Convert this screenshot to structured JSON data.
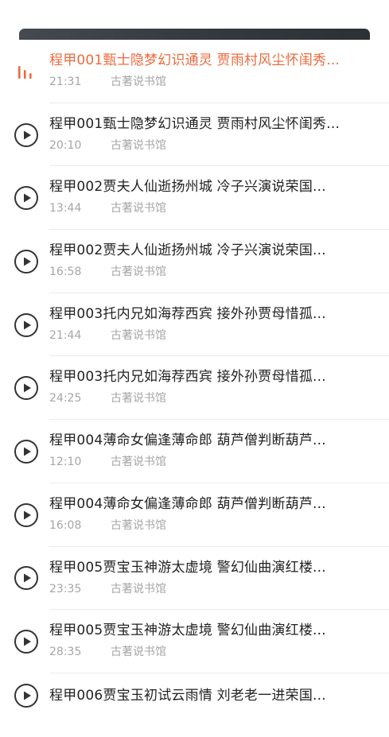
{
  "player": {
    "active_icon": "playing-bars-icon",
    "play_icon": "play-circle-icon",
    "accent_color": "#ec6a3e"
  },
  "episodes": [
    {
      "title": "程甲001甄士隐梦幻识通灵 贾雨村风尘怀闺秀...",
      "duration": "21:31",
      "author": "古著说书馆",
      "playing": true
    },
    {
      "title": "程甲001甄士隐梦幻识通灵 贾雨村风尘怀闺秀...",
      "duration": "20:10",
      "author": "古著说书馆"
    },
    {
      "title": "程甲002贾夫人仙逝扬州城 冷子兴演说荣国...",
      "duration": "13:44",
      "author": "古著说书馆"
    },
    {
      "title": "程甲002贾夫人仙逝扬州城 冷子兴演说荣国...",
      "duration": "16:58",
      "author": "古著说书馆"
    },
    {
      "title": "程甲003托内兄如海荐西宾 接外孙贾母惜孤...",
      "duration": "21:44",
      "author": "古著说书馆"
    },
    {
      "title": "程甲003托内兄如海荐西宾 接外孙贾母惜孤...",
      "duration": "24:25",
      "author": "古著说书馆"
    },
    {
      "title": "程甲004薄命女偏逢薄命郎 葫芦僧判断葫芦...",
      "duration": "12:10",
      "author": "古著说书馆"
    },
    {
      "title": "程甲004薄命女偏逢薄命郎 葫芦僧判断葫芦...",
      "duration": "16:08",
      "author": "古著说书馆"
    },
    {
      "title": "程甲005贾宝玉神游太虚境 警幻仙曲演红楼...",
      "duration": "23:35",
      "author": "古著说书馆"
    },
    {
      "title": "程甲005贾宝玉神游太虚境 警幻仙曲演红楼...",
      "duration": "28:35",
      "author": "古著说书馆"
    },
    {
      "title": "程甲006贾宝玉初试云雨情 刘老老一进荣国...",
      "duration": "",
      "author": ""
    }
  ]
}
